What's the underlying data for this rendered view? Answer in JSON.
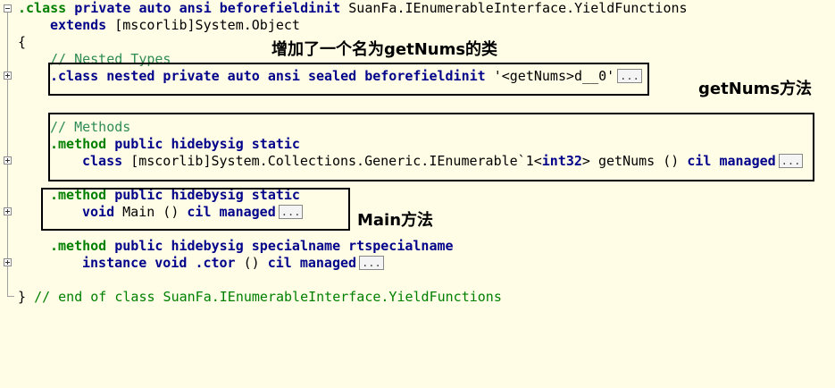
{
  "code": {
    "class_decl": {
      "kw1": ".class",
      "kw2": "private auto ansi beforefieldinit",
      "name": "SuanFa.IEnumerableInterface.YieldFunctions"
    },
    "extends": {
      "kw": "extends",
      "type": "[mscorlib]System.Object"
    },
    "open_brace": "{",
    "nested_comment": "// Nested Types",
    "nested_class": {
      "kw": ".class nested private auto ansi sealed beforefieldinit",
      "name": "'<getNums>d__0'",
      "ellipsis": "..."
    },
    "methods_comment": "// Methods",
    "method_getnums": {
      "head_kw": ".method",
      "head_rest": "public hidebysig static",
      "body_kw": "class",
      "body_type": "[mscorlib]System.Collections.Generic.IEnumerable`1<",
      "body_int": "int32",
      "body_after": "> getNums ()",
      "body_tail": "cil managed",
      "ellipsis": "..."
    },
    "method_main": {
      "head_kw": ".method",
      "head_rest": "public hidebysig static",
      "body_kw": "void",
      "body_name": "Main ()",
      "body_tail": "cil managed",
      "ellipsis": "..."
    },
    "method_ctor": {
      "head_kw": ".method",
      "head_rest": "public hidebysig specialname rtspecialname",
      "body_kw": "instance void",
      "body_name": ".ctor",
      "body_parens": "()",
      "body_tail": "cil managed",
      "ellipsis": "..."
    },
    "close": {
      "brace": "}",
      "comment": "// end of class SuanFa.IEnumerableInterface.YieldFunctions"
    }
  },
  "annotations": {
    "nested_type": "增加了一个名为getNums的类",
    "getnums_method": "getNums方法",
    "main_method": "Main方法"
  }
}
